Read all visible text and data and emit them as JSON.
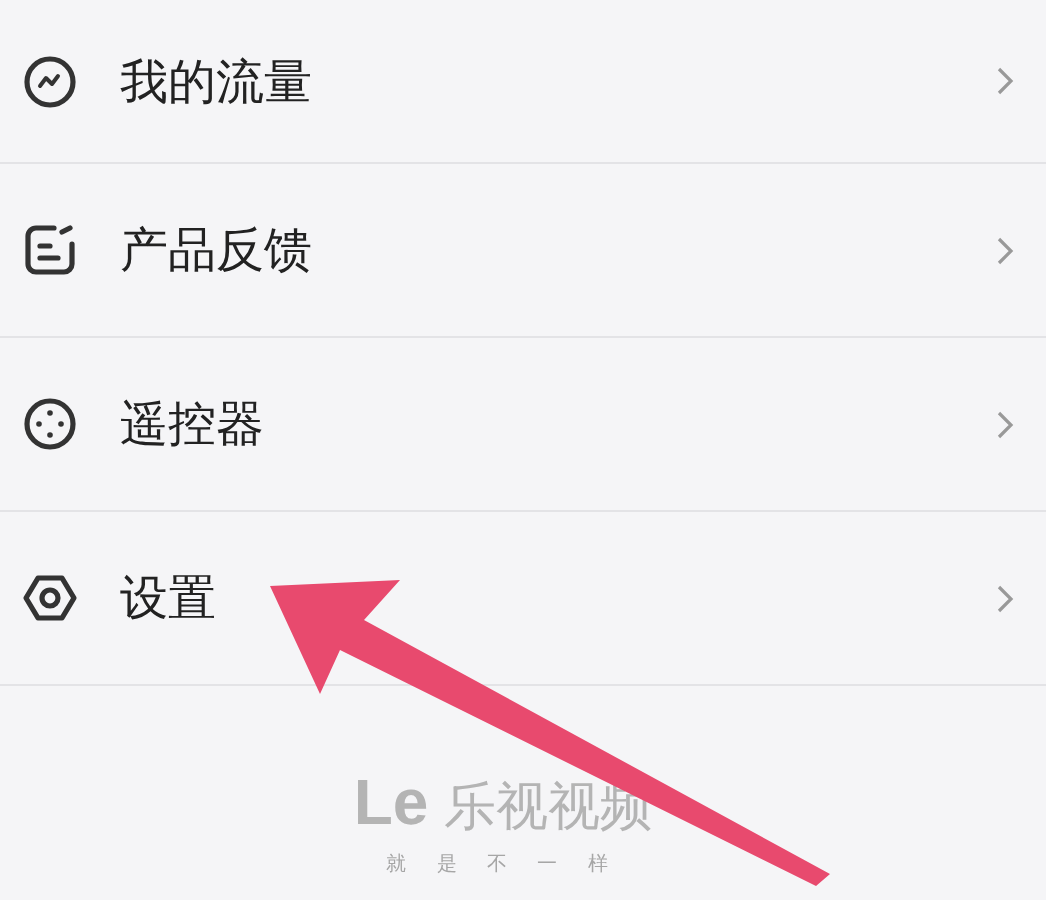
{
  "menu": [
    {
      "label": "我的流量",
      "kind": "traffic"
    },
    {
      "label": "产品反馈",
      "kind": "feedback"
    },
    {
      "label": "遥控器",
      "kind": "remote"
    },
    {
      "label": "设置",
      "kind": "settings"
    }
  ],
  "footer": {
    "brand_mark": "Le",
    "brand_name": "乐视视频",
    "slogan": "就 是 不 一 样"
  }
}
